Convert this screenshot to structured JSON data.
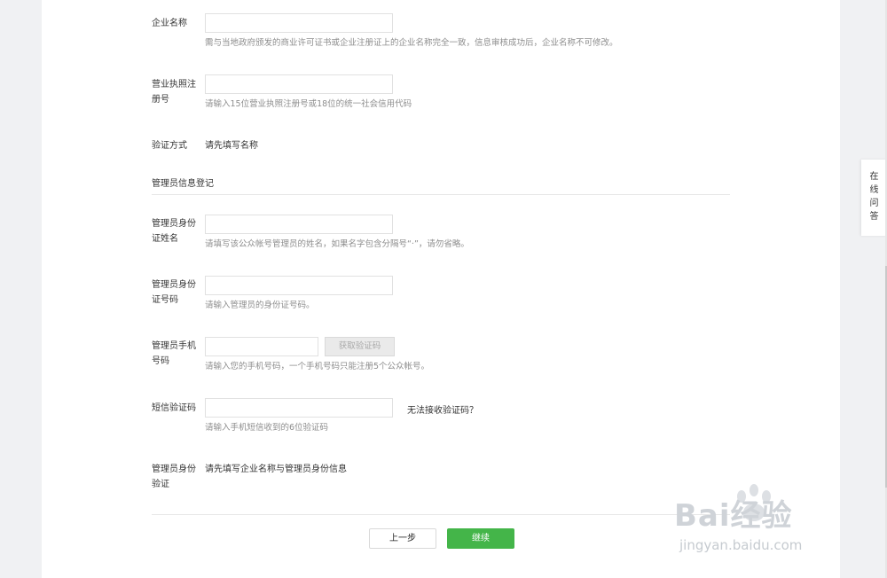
{
  "form": {
    "company_name": {
      "label": "企业名称",
      "value": "",
      "hint": "需与当地政府颁发的商业许可证书或企业注册证上的企业名称完全一致，信息审核成功后，企业名称不可修改。"
    },
    "license_no": {
      "label_line1": "营业执照注",
      "label_line2": "册号",
      "value": "",
      "hint": "请输入15位营业执照注册号或18位的统一社会信用代码"
    },
    "verify_method": {
      "label": "验证方式",
      "value": "请先填写名称"
    },
    "admin_section_title": "管理员信息登记",
    "admin_name": {
      "label_line1": "管理员身份",
      "label_line2": "证姓名",
      "value": "",
      "hint": "请填写该公众帐号管理员的姓名，如果名字包含分隔号“·”，请勿省略。"
    },
    "admin_id": {
      "label_line1": "管理员身份",
      "label_line2": "证号码",
      "value": "",
      "hint": "请输入管理员的身份证号码。"
    },
    "admin_phone": {
      "label_line1": "管理员手机",
      "label_line2": "号码",
      "value": "",
      "hint": "请输入您的手机号码，一个手机号码只能注册5个公众帐号。",
      "get_code_label": "获取验证码"
    },
    "sms_code": {
      "label": "短信验证码",
      "value": "",
      "hint": "请输入手机短信收到的6位验证码",
      "no_code_link": "无法接收验证码？"
    },
    "admin_verify": {
      "label_line1": "管理员身份",
      "label_line2": "验证",
      "value": "请先填写企业名称与管理员身份信息"
    }
  },
  "actions": {
    "prev_label": "上一步",
    "next_label": "继续"
  },
  "side_qa": {
    "chars": [
      "在",
      "线",
      "问",
      "答"
    ]
  },
  "watermark": {
    "main": "Bai经验",
    "sub": "jingyan.baidu.com"
  },
  "colors": {
    "primary_green": "#44b549",
    "hint_gray": "#8d8d8d",
    "border_gray": "#e1e1e1",
    "background": "#f0f1f3"
  }
}
